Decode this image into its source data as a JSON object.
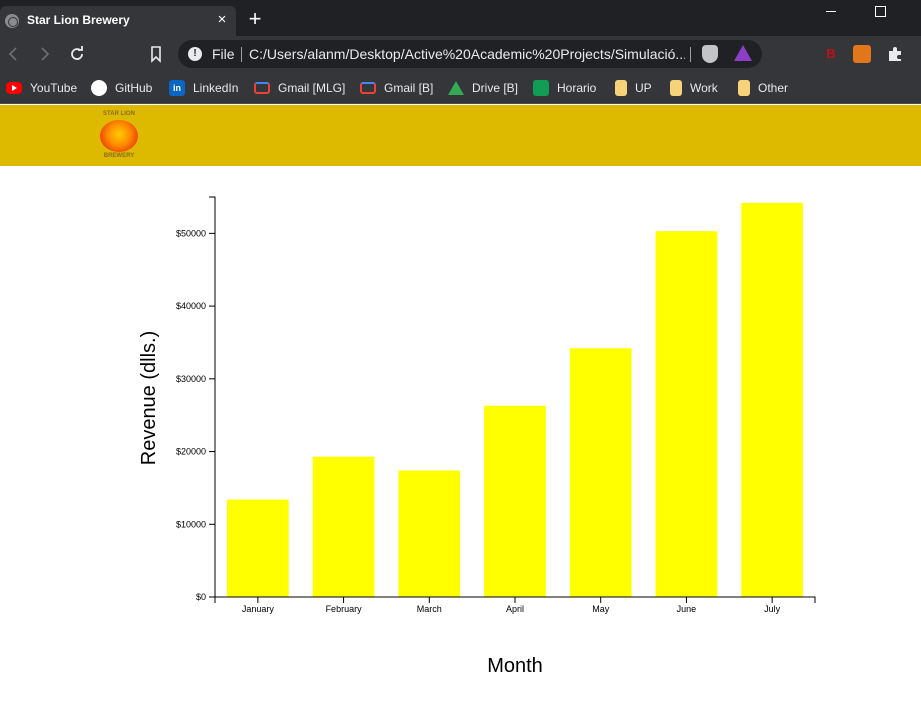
{
  "browser": {
    "tab_title": "Star Lion Brewery",
    "tab_close": "×",
    "new_tab": "+",
    "file_chip": "File",
    "url": "C:/Users/alanm/Desktop/Active%20Academic%20Projects/Simulació..."
  },
  "bookmarks": [
    {
      "label": "YouTube",
      "icon": "youtube-icon"
    },
    {
      "label": "GitHub",
      "icon": "github-icon"
    },
    {
      "label": "LinkedIn",
      "icon": "linkedin-icon"
    },
    {
      "label": "Gmail [MLG]",
      "icon": "gmail-icon"
    },
    {
      "label": "Gmail [B]",
      "icon": "gmail-icon"
    },
    {
      "label": "Drive [B]",
      "icon": "drive-icon"
    },
    {
      "label": "Horario",
      "icon": "sheets-icon"
    },
    {
      "label": "UP",
      "icon": "folder-icon"
    },
    {
      "label": "Work",
      "icon": "folder-icon"
    },
    {
      "label": "Other",
      "icon": "folder-icon"
    }
  ],
  "site": {
    "logo_top": "STAR LION",
    "logo_bottom": "BREWERY",
    "header_color": "#ddb900"
  },
  "chart_data": {
    "type": "bar",
    "categories": [
      "January",
      "February",
      "March",
      "April",
      "May",
      "June",
      "July"
    ],
    "values": [
      13400,
      19300,
      17400,
      26300,
      34200,
      50300,
      54200
    ],
    "xlabel": "Month",
    "ylabel": "Revenue (dlls.)",
    "ylim": [
      0,
      55000
    ],
    "yticks": [
      0,
      10000,
      20000,
      30000,
      40000,
      50000
    ],
    "ytick_labels": [
      "$0",
      "$10000",
      "$20000",
      "$30000",
      "$40000",
      "$50000"
    ],
    "bar_color": "#ffff00",
    "grid": false
  }
}
